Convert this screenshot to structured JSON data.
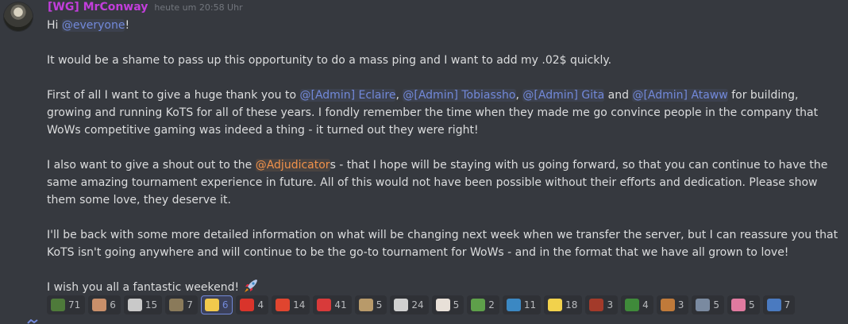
{
  "message": {
    "author": "[WG] MrConway",
    "timestamp": "heute um 20:58 Uhr",
    "greeting": {
      "pre": "Hi ",
      "mention": "@everyone",
      "post": "!"
    },
    "p1": "It would be a shame to pass up this opportunity to do a mass ping and I want to add my .02$ quickly.",
    "p2": {
      "pre": "First of all I want to give a huge thank you to ",
      "m1": "@[Admin] Eclaire",
      "s1": ", ",
      "m2": "@[Admin] Tobiassho",
      "s2": ", ",
      "m3": "@[Admin] Gita",
      "s3": " and ",
      "m4": "@[Admin] Ataww",
      "post": " for building, growing and running KoTS for all of these years. I fondly remember the time when they made me go convince people in the company that WoWs competitive gaming was indeed a thing - it turned out they were right!"
    },
    "p3": {
      "pre": "I also want to give a shout out to the ",
      "mention": "@Adjudicator",
      "post": "s - that I hope will be staying with us going forward, so that you can continue to have the same amazing tournament experience in future. All of this would not have been possible without their efforts and dedication. Please show them some love, they deserve it."
    },
    "p4": "I'll be back with some more detailed information on what will be changing next week when we transfer the server, but I can reassure you that KoTS isn't going anywhere and will continue to be the go-to tournament for WoWs - and in the format that we have all grown to love!",
    "p5": "I wish you all a fantastic weekend! ",
    "colors": {
      "author": "#c23edb",
      "mention_blue": "#7289da",
      "mention_orange": "#f0914a",
      "background": "#36393f"
    }
  },
  "reactions": [
    {
      "icon": "frog-emoji-icon",
      "color": "#4e7a3a",
      "count": "71",
      "me": false
    },
    {
      "icon": "face-emoji-icon",
      "color": "#c98f6a",
      "count": "6",
      "me": false
    },
    {
      "icon": "flag-emoji-icon",
      "color": "#c9c9c9",
      "count": "15",
      "me": false
    },
    {
      "icon": "soldier-emoji-icon",
      "color": "#8a7a5a",
      "count": "7",
      "me": false
    },
    {
      "icon": "pikachu-emoji-icon",
      "color": "#f2c94c",
      "count": "6",
      "me": true
    },
    {
      "icon": "devil-emoji-icon",
      "color": "#d9342b",
      "count": "4",
      "me": false
    },
    {
      "icon": "fire-emoji-icon",
      "color": "#e0452f",
      "count": "14",
      "me": false
    },
    {
      "icon": "no-emoji-icon",
      "color": "#d83a3a",
      "count": "41",
      "me": false
    },
    {
      "icon": "bird-emoji-icon",
      "color": "#b89a6a",
      "count": "5",
      "me": false
    },
    {
      "icon": "banner-emoji-icon",
      "color": "#d0d0d0",
      "count": "24",
      "me": false
    },
    {
      "icon": "cup-emoji-icon",
      "color": "#e8e0d8",
      "count": "5",
      "me": false
    },
    {
      "icon": "pepe-emoji-icon",
      "color": "#5ea04a",
      "count": "2",
      "me": false
    },
    {
      "icon": "restroom-emoji-icon",
      "color": "#3b88c3",
      "count": "11",
      "me": false
    },
    {
      "icon": "bar-emoji-icon",
      "color": "#f2d24c",
      "count": "18",
      "me": false
    },
    {
      "icon": "splat-emoji-icon",
      "color": "#a33a2a",
      "count": "3",
      "me": false
    },
    {
      "icon": "frog-face-emoji-icon",
      "color": "#3f8a3a",
      "count": "4",
      "me": false
    },
    {
      "icon": "person-emoji-icon",
      "color": "#c07a3a",
      "count": "3",
      "me": false
    },
    {
      "icon": "ship-emoji-icon",
      "color": "#7a8aa0",
      "count": "5",
      "me": false
    },
    {
      "icon": "heart-emoji-icon",
      "color": "#e07aa0",
      "count": "5",
      "me": false
    },
    {
      "icon": "ship-blue-emoji-icon",
      "color": "#4a7ac0",
      "count": "7",
      "me": false
    }
  ]
}
